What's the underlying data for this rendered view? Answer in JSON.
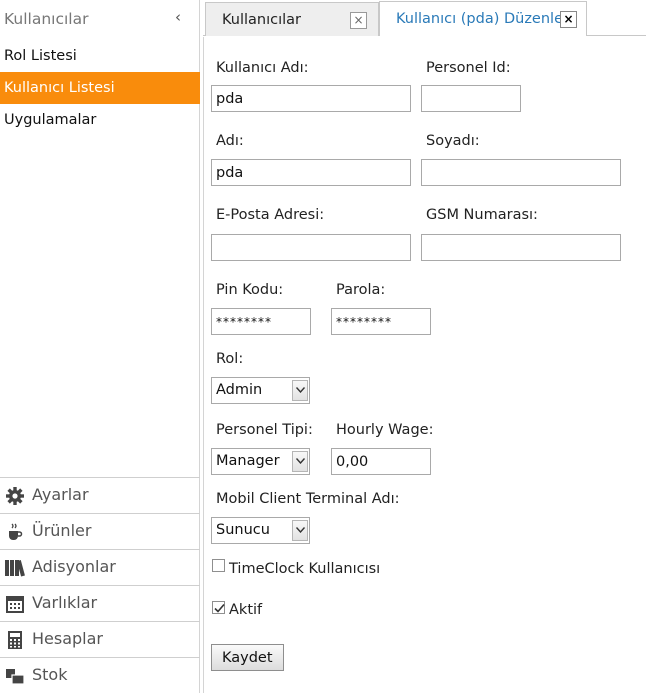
{
  "sidebar": {
    "title": "Kullanıcılar",
    "collapse_glyph": "‹",
    "items": [
      {
        "label": "Rol Listesi",
        "active": false
      },
      {
        "label": "Kullanıcı Listesi",
        "active": true
      },
      {
        "label": "Uygulamalar",
        "active": false
      }
    ],
    "accent_color": "#f98c0c",
    "bottom_nav": [
      {
        "label": "Ayarlar",
        "icon": "gear-icon"
      },
      {
        "label": "Ürünler",
        "icon": "coffee-cup-icon"
      },
      {
        "label": "Adisyonlar",
        "icon": "books-icon"
      },
      {
        "label": "Varlıklar",
        "icon": "calendar-icon"
      },
      {
        "label": "Hesaplar",
        "icon": "calculator-icon"
      },
      {
        "label": "Stok",
        "icon": "stock-icon"
      }
    ]
  },
  "tabs": [
    {
      "label": "Kullanıcılar",
      "close": "×",
      "active": false
    },
    {
      "label": "Kullanıcı (pda) Düzenle",
      "close": "×",
      "active": true
    }
  ],
  "form": {
    "username": {
      "label": "Kullanıcı Adı:",
      "value": "pda"
    },
    "personnel_id": {
      "label": "Personel Id:",
      "value": ""
    },
    "first_name": {
      "label": "Adı:",
      "value": "pda"
    },
    "last_name": {
      "label": "Soyadı:",
      "value": ""
    },
    "email": {
      "label": "E-Posta Adresi:",
      "value": ""
    },
    "gsm": {
      "label": "GSM Numarası:",
      "value": ""
    },
    "pin": {
      "label": "Pin Kodu:",
      "value": "********"
    },
    "password": {
      "label": "Parola:",
      "value": "********"
    },
    "role": {
      "label": "Rol:",
      "value": "Admin"
    },
    "personnel_type": {
      "label": "Personel Tipi:",
      "value": "Manager"
    },
    "hourly_wage": {
      "label": "Hourly Wage:",
      "value": "0,00"
    },
    "terminal": {
      "label": "Mobil Client Terminal Adı:",
      "value": "Sunucu"
    },
    "timeclock": {
      "label": "TimeClock Kullanıcısı",
      "checked": false
    },
    "active": {
      "label": "Aktif",
      "checked": true
    },
    "save_label": "Kaydet"
  }
}
